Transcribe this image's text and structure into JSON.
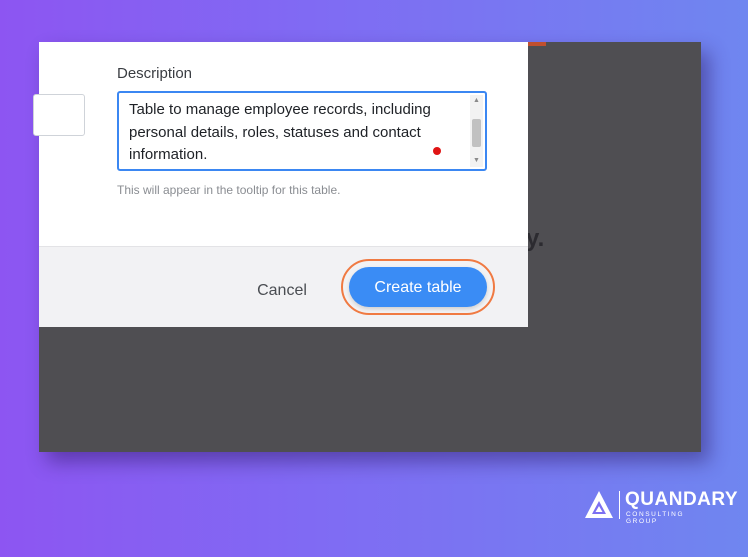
{
  "dialog": {
    "description_label": "Description",
    "description_value": "Table to manage employee records, including personal details, roles, statuses and contact information.",
    "help_text": "This will appear in the tooltip for this table.",
    "cancel_label": "Cancel",
    "create_label": "Create table"
  },
  "background": {
    "partial_text": "y."
  },
  "logo": {
    "name": "QUANDARY",
    "subtitle": "CONSULTING GROUP"
  },
  "colors": {
    "primary_button": "#3a8cf5",
    "highlight_ring": "#f07a42",
    "focus_border": "#3b87f2",
    "background_gradient_start": "#8d55f2",
    "background_gradient_end": "#6f86f0"
  },
  "icons": {
    "scroll_up": "scroll-up-arrow-icon",
    "scroll_down": "scroll-down-arrow-icon",
    "logo_mark": "quandary-triangle-logo-icon"
  }
}
